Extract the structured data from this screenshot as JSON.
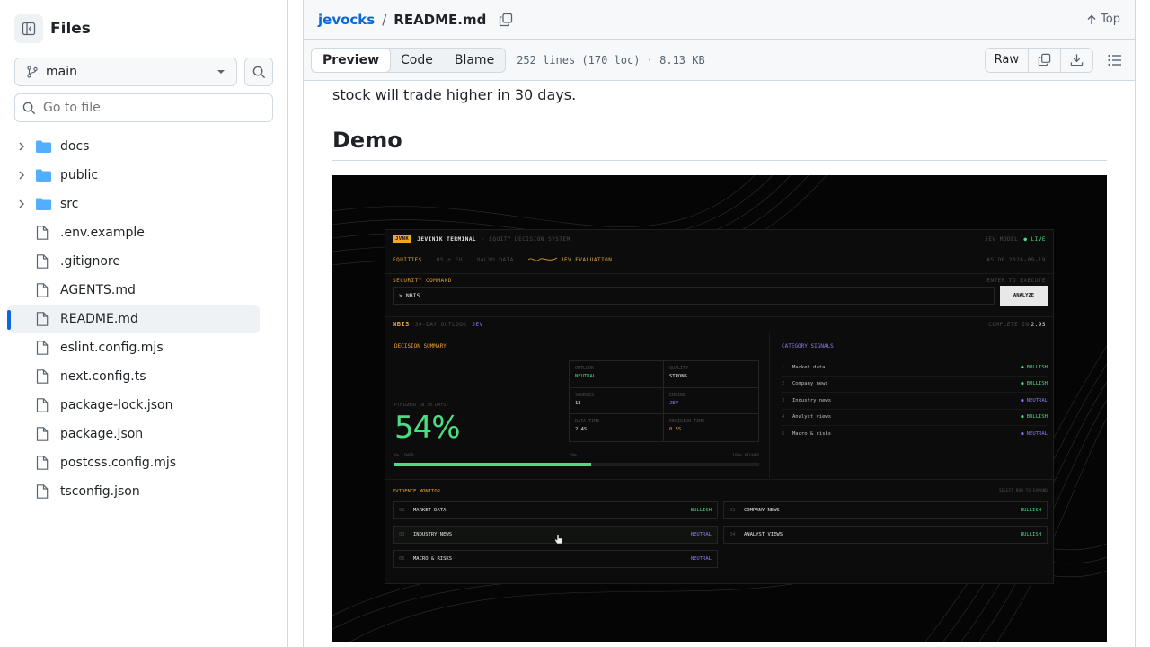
{
  "sidebar": {
    "title": "Files",
    "branch": "main",
    "goto_placeholder": "Go to file",
    "items": [
      {
        "name": "docs",
        "type": "folder"
      },
      {
        "name": "public",
        "type": "folder"
      },
      {
        "name": "src",
        "type": "folder"
      },
      {
        "name": ".env.example",
        "type": "file"
      },
      {
        "name": ".gitignore",
        "type": "file"
      },
      {
        "name": "AGENTS.md",
        "type": "file"
      },
      {
        "name": "README.md",
        "type": "file",
        "active": true
      },
      {
        "name": "eslint.config.mjs",
        "type": "file"
      },
      {
        "name": "next.config.ts",
        "type": "file"
      },
      {
        "name": "package-lock.json",
        "type": "file"
      },
      {
        "name": "package.json",
        "type": "file"
      },
      {
        "name": "postcss.config.mjs",
        "type": "file"
      },
      {
        "name": "tsconfig.json",
        "type": "file"
      }
    ]
  },
  "header": {
    "repo": "jevocks",
    "separator": "/",
    "file": "README.md",
    "top_label": "Top"
  },
  "toolbar": {
    "tabs": [
      "Preview",
      "Code",
      "Blame"
    ],
    "meta": "252 lines (170 loc) · 8.13 KB",
    "raw_label": "Raw"
  },
  "readme": {
    "paragraph_tail": "stock will trade higher in 30 days.",
    "heading": "Demo"
  },
  "demo_image": {
    "brand_tag": "JVNK",
    "brand_name": "JEVINIK TERMINAL",
    "brand_sub": "· EQUITY DECISION SYSTEM",
    "model": "JEV MODEL",
    "live": "● LIVE",
    "nav": [
      "EQUITIES",
      "US + EU",
      "VALYU DATA",
      "JEV EVALUATION"
    ],
    "asof": "AS OF 2026-09-19",
    "security_command_label": "SECURITY COMMAND",
    "enter_hint": "ENTER TO EXECUTE",
    "command_value": "> NBIS",
    "analyze_label": "ANALYZE",
    "ticker": "NBIS",
    "outlook_label": "30-DAY OUTLOOK",
    "engine_tag": "JEV",
    "complete_label": "COMPLETE IN",
    "complete_value": "2.9S",
    "decision_summary": "DECISION SUMMARY",
    "prob_label": "P(HIGHER IN 30 DAYS)",
    "prob_value": "54%",
    "progress_fraction": 0.54,
    "scale": [
      "0% LOWER",
      "50%",
      "100% HIGHER"
    ],
    "stats": [
      {
        "label": "OUTLOOK",
        "value": "NEUTRAL"
      },
      {
        "label": "QUALITY",
        "value": "STRONG"
      },
      {
        "label": "SOURCES",
        "value": "13"
      },
      {
        "label": "ENGINE",
        "value": "JEV"
      },
      {
        "label": "DATA TIME",
        "value": "2.4S"
      },
      {
        "label": "DECISION TIME",
        "value": "0.5S"
      }
    ],
    "category_signals": "CATEGORY SIGNALS",
    "signals": [
      {
        "n": "1",
        "name": "Market data",
        "value": "● BULLISH"
      },
      {
        "n": "2",
        "name": "Company news",
        "value": "● BULLISH"
      },
      {
        "n": "3",
        "name": "Industry news",
        "value": "● NEUTRAL"
      },
      {
        "n": "4",
        "name": "Analyst views",
        "value": "● BULLISH"
      },
      {
        "n": "5",
        "name": "Macro & risks",
        "value": "● NEUTRAL"
      }
    ],
    "evidence_monitor": "EVIDENCE MONITOR",
    "expand_hint": "SELECT ROW TO EXPAND",
    "evidence": [
      {
        "n": "01",
        "name": "MARKET DATA",
        "value": "BULLISH"
      },
      {
        "n": "02",
        "name": "COMPANY NEWS",
        "value": "BULLISH"
      },
      {
        "n": "03",
        "name": "INDUSTRY NEWS",
        "value": "NEUTRAL"
      },
      {
        "n": "04",
        "name": "ANALYST VIEWS",
        "value": "BULLISH"
      },
      {
        "n": "05",
        "name": "MACRO & RISKS",
        "value": "NEUTRAL"
      }
    ]
  }
}
